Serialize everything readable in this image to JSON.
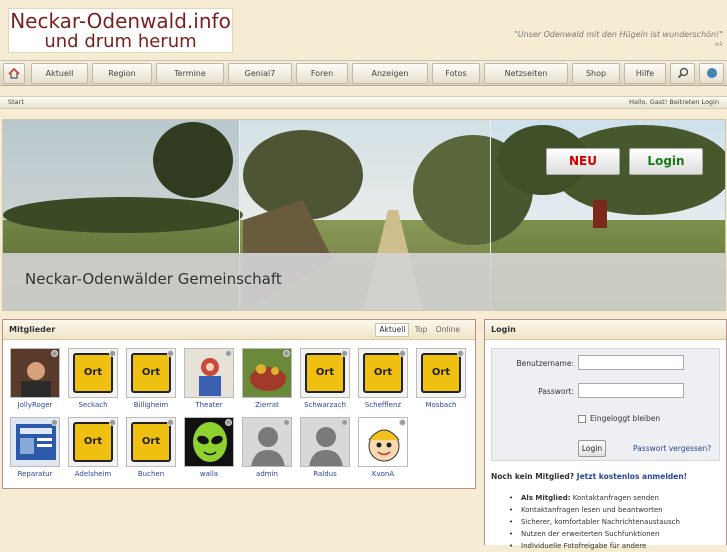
{
  "header": {
    "logo_line1": "Neckar-Odenwald.info",
    "logo_line2": "und drum herum",
    "slogan": "\"Unser Odenwald mit den Hügeln ist wunderschön!\"",
    "slogan_author": "wk"
  },
  "nav": {
    "items": [
      "Aktuell",
      "Region",
      "Termine",
      "Genial7",
      "Foren",
      "Anzeigen",
      "Fotos",
      "Netzseiten",
      "Shop",
      "Hilfe"
    ],
    "icons": [
      "home-icon",
      "search-icon",
      "globe-icon"
    ]
  },
  "infobar": {
    "breadcrumb": "Start",
    "greeting": "Hallo, Gast! Beitreten Login"
  },
  "banner": {
    "title": "Neckar-Odenwälder Gemeinschaft",
    "new_button": "NEU",
    "login_button": "Login"
  },
  "members": {
    "title": "Mitglieder",
    "tabs": [
      "Aktuell",
      "Top",
      "Online"
    ],
    "active_tab": "Aktuell",
    "list": [
      {
        "name": "JollyRoger",
        "type": "photo"
      },
      {
        "name": "Seckach",
        "type": "ort"
      },
      {
        "name": "Billigheim",
        "type": "ort"
      },
      {
        "name": "Theater",
        "type": "photo"
      },
      {
        "name": "Zierrat",
        "type": "photo"
      },
      {
        "name": "Schwarzach",
        "type": "ort"
      },
      {
        "name": "Schefflenz",
        "type": "ort"
      },
      {
        "name": "Mosbach",
        "type": "ort"
      },
      {
        "name": "Reparatur",
        "type": "photo"
      },
      {
        "name": "Adelsheim",
        "type": "ort"
      },
      {
        "name": "Buchen",
        "type": "ort"
      },
      {
        "name": "walla",
        "type": "alien"
      },
      {
        "name": "admin",
        "type": "silhouette"
      },
      {
        "name": "Raldus",
        "type": "silhouette"
      },
      {
        "name": "KvonA",
        "type": "cartoon"
      }
    ],
    "ort_label": "Ort"
  },
  "login": {
    "title": "Login",
    "username_label": "Benutzername:",
    "password_label": "Passwort:",
    "remember_label": "Eingeloggt bleiben",
    "submit_label": "Login",
    "forgot_link": "Passwort vergessen?",
    "no_account": "Noch kein Mitglied?",
    "register_link": "Jetzt kostenlos anmelden!",
    "benefits_lead": "Als Mitglied:",
    "benefits": [
      "Kontaktanfragen senden",
      "Kontaktanfragen lesen und beantworten",
      "Sicherer, komfortabler Nachrichtenaustausch",
      "Nutzen der erweiterten Suchfunktionen",
      "Individuelle Fotofreigabe für andere"
    ]
  },
  "colors": {
    "background": "#f6ecd3",
    "logo_text": "#7a1f1f",
    "box_border": "#b78e8e",
    "link": "#2a47a0",
    "neu": "#cc0000",
    "login_green": "#1a7a1a",
    "ort_sign": "#f0c010"
  }
}
